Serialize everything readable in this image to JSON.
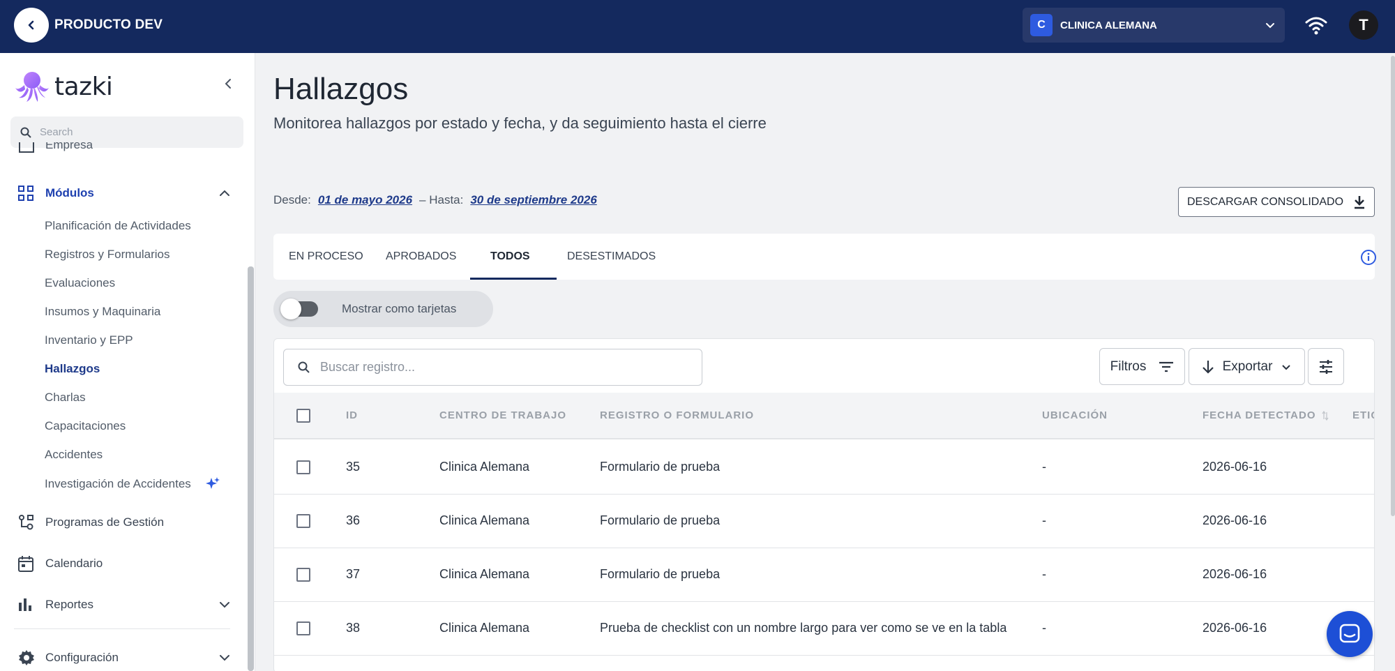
{
  "topbar": {
    "title": "PRODUCTO DEV",
    "company_badge": "C",
    "company_name": "CLINICA ALEMANA",
    "user_initial": "T",
    "color": "#14295e"
  },
  "sidebar": {
    "logo_text": "tazki",
    "search_placeholder": "Search",
    "cut_item_label": "Empresa",
    "modules_label": "Módulos",
    "sub_items": [
      "Planificación de Actividades",
      "Registros y Formularios",
      "Evaluaciones",
      "Insumos y Maquinaria",
      "Inventario y EPP",
      "Hallazgos",
      "Charlas",
      "Capacitaciones",
      "Accidentes",
      "Investigación de Accidentes"
    ],
    "active_sub_item": "Hallazgos",
    "items": [
      {
        "label": "Programas de Gestión",
        "icon": "flowchart-icon"
      },
      {
        "label": "Calendario",
        "icon": "calendar-icon"
      },
      {
        "label": "Reportes",
        "icon": "bar-chart-icon"
      },
      {
        "label": "Configuración",
        "icon": "gear-icon"
      }
    ]
  },
  "page": {
    "title": "Hallazgos",
    "subtitle": "Monitorea hallazgos por estado y fecha, y da seguimiento hasta el cierre",
    "from_label": "Desde:",
    "from_date": "01 de mayo 2026",
    "to_label": "– Hasta:",
    "to_date": "30 de septiembre 2026",
    "download_label": "DESCARGAR CONSOLIDADO"
  },
  "tabs": [
    "EN PROCESO",
    "APROBADOS",
    "TODOS",
    "DESESTIMADOS"
  ],
  "active_tab": "TODOS",
  "toggle": {
    "label": "Mostrar como tarjetas",
    "on": false
  },
  "table": {
    "search_placeholder": "Buscar registro...",
    "filters_label": "Filtros",
    "export_label": "Exportar",
    "columns": [
      "ID",
      "CENTRO DE TRABAJO",
      "REGISTRO O FORMULARIO",
      "UBICACIÓN",
      "FECHA DETECTADO",
      "ETIQ"
    ],
    "rows": [
      {
        "id": "35",
        "centro": "Clinica Alemana",
        "registro": "Formulario de prueba",
        "ubicacion": "-",
        "fecha": "2026-06-16"
      },
      {
        "id": "36",
        "centro": "Clinica Alemana",
        "registro": "Formulario de prueba",
        "ubicacion": "-",
        "fecha": "2026-06-16"
      },
      {
        "id": "37",
        "centro": "Clinica Alemana",
        "registro": "Formulario de prueba",
        "ubicacion": "-",
        "fecha": "2026-06-16"
      },
      {
        "id": "38",
        "centro": "Clinica Alemana",
        "registro": "Prueba de checklist con un nombre largo para ver como se ve en la tabla",
        "ubicacion": "-",
        "fecha": "2026-06-16"
      }
    ]
  },
  "colors": {
    "accent": "#1e3a8a",
    "fab": "#1d4fd6"
  }
}
